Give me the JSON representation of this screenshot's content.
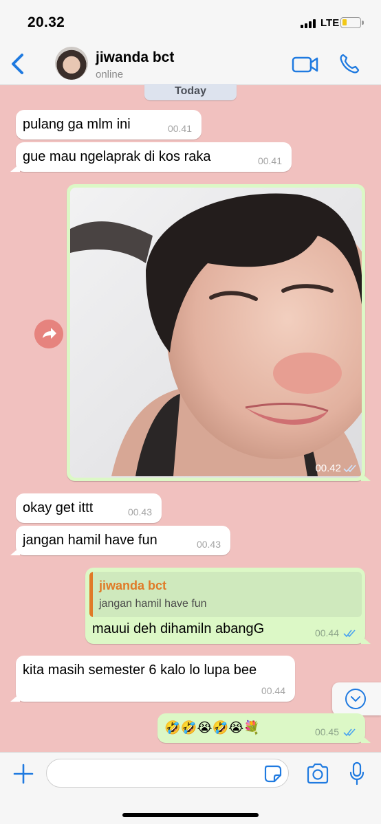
{
  "status_bar": {
    "time": "20.32",
    "network": "LTE",
    "battery_level": 0.25
  },
  "header": {
    "contact_name": "jiwanda bct",
    "contact_status": "online"
  },
  "date_divider": "Today",
  "messages": [
    {
      "text": "pulang ga mlm ini",
      "time": "00.41"
    },
    {
      "text": "gue mau ngelaprak di kos raka",
      "time": "00.41"
    },
    {
      "time": "00.42"
    },
    {
      "text": "okay get ittt",
      "time": "00.43"
    },
    {
      "text": "jangan hamil have fun",
      "time": "00.43"
    },
    {
      "reply_to": {
        "name": "jiwanda bct",
        "text": "jangan hamil have fun"
      },
      "text": "mauui deh dihamiln abangG",
      "time": "00.44"
    },
    {
      "text": "kita masih semester 6 kalo lo lupa bee",
      "time": "00.44"
    },
    {
      "text": "🤣🤣😭🤣😭💐",
      "time": "00.45"
    }
  ],
  "colors": {
    "accent": "#1f7ae0",
    "background": "#f1c1bf",
    "outgoing_bubble": "#dcf8c6",
    "reply_name": "#e07a27"
  }
}
